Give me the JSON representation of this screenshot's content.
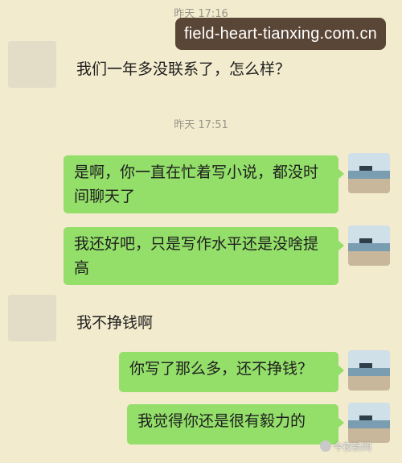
{
  "timestamps": [
    "昨天 17:16",
    "昨天 17:51"
  ],
  "watermark": "field-heart-tianxing.com.cn",
  "messages": [
    {
      "side": "in",
      "text": "我们一年多没联系了，怎么样？"
    },
    {
      "side": "out",
      "text": "是啊，你一直在忙着写小说，都没时间聊天了"
    },
    {
      "side": "out",
      "text": "我还好吧，只是写作水平还是没啥提高"
    },
    {
      "side": "in",
      "text": "我不挣钱啊"
    },
    {
      "side": "out",
      "text": "你写了那么多，还不挣钱？"
    },
    {
      "side": "out",
      "text": "我觉得你还是很有毅力的"
    }
  ],
  "credit": "今夜新闻",
  "colors": {
    "background": "#f2ebcd",
    "outgoing_bubble": "#93df6a",
    "timestamp": "#9a968a"
  }
}
